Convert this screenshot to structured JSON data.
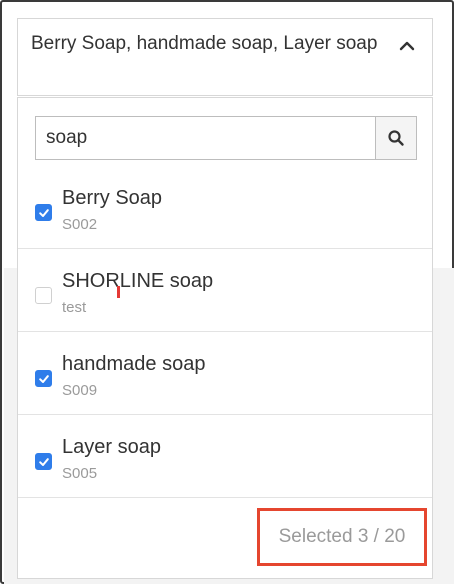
{
  "select": {
    "display_text": "Berry Soap, handmade soap, Layer soap"
  },
  "search": {
    "value": "soap",
    "button_icon": "search-icon"
  },
  "options": [
    {
      "label": "Berry Soap",
      "code": "S002",
      "checked": true
    },
    {
      "label": "SHORLINE soap",
      "code": "test",
      "checked": false
    },
    {
      "label": "handmade soap",
      "code": "S009",
      "checked": true
    },
    {
      "label": "Layer soap",
      "code": "S005",
      "checked": true
    }
  ],
  "footer": {
    "selected_count": "Selected 3 / 20"
  },
  "colors": {
    "checkbox_checked": "#2f7dea",
    "highlight_border": "#e5462f"
  }
}
